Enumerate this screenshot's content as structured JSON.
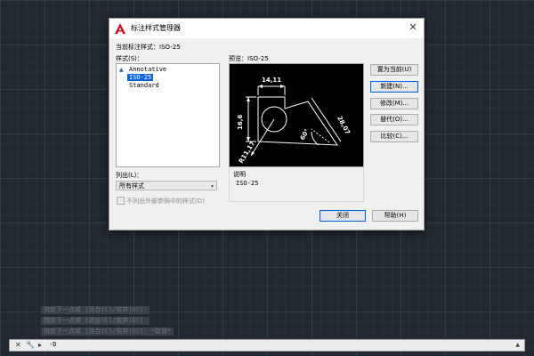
{
  "dialog": {
    "title": "标注样式管理器",
    "current_style_label": "当前标注样式：ISO-25",
    "styles_label": "样式(S)：",
    "preview_label": "预览：ISO-25",
    "styles": [
      "Annotative",
      "ISO-25",
      "Standard"
    ],
    "selected_style": "ISO-25",
    "list_label": "列出(L)：",
    "list_value": "所有样式",
    "exclude_xref_label": "不列出外部参照中的样式(D)",
    "description_label": "说明",
    "description_value": "ISO-25",
    "buttons": {
      "set_current": "置为当前(U)",
      "new": "新建(N)...",
      "modify": "修改(M)...",
      "override": "替代(O)...",
      "compare": "比较(C)...",
      "close": "关闭",
      "help": "帮助(H)"
    },
    "preview_dims": {
      "top": "14,11",
      "left": "16,6",
      "right": "28,07",
      "angle": "60°",
      "radius": "R11,17"
    }
  },
  "command_line": {
    "history": [
      "指定下一点或 [闭合(C)/放弃(U)]:",
      "指定下一点或 [闭合(C)/放弃(U)]:",
      "指定下一点或 [闭合(C)/放弃(U)]: *取消*"
    ],
    "prompt": "-D",
    "close_icon": "close-icon",
    "wrench_icon": "wrench-icon"
  },
  "colors": {
    "selection": "#0a64d8",
    "autocad_red": "#c8102e"
  }
}
